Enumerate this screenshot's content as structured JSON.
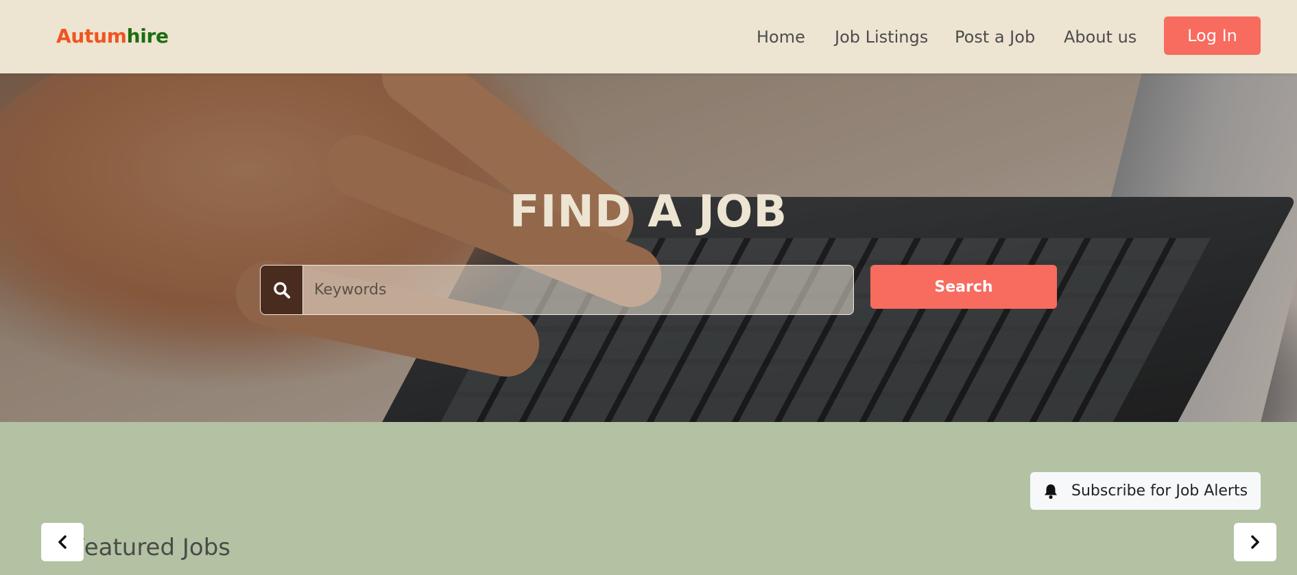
{
  "header": {
    "logo_part1": "Autum",
    "logo_part2": "hire",
    "nav": [
      "Home",
      "Job Listings",
      "Post a Job",
      "About us"
    ],
    "login_label": "Log In"
  },
  "hero": {
    "title": "FIND A JOB",
    "search_placeholder": "Keywords",
    "search_label": "Search",
    "search_icon": "search-icon"
  },
  "alerts": {
    "subscribe_label": "Subscribe for Job Alerts",
    "icon": "bell-icon"
  },
  "featured": {
    "title": "Featured Jobs",
    "prev_icon": "chevron-left-icon",
    "next_icon": "chevron-right-icon"
  },
  "colors": {
    "header_bg": "#ede4d2",
    "accent": "#f86b5f",
    "logo_orange": "#f0541f",
    "logo_green": "#1e6d12",
    "section_bg": "#b2c2a2"
  }
}
